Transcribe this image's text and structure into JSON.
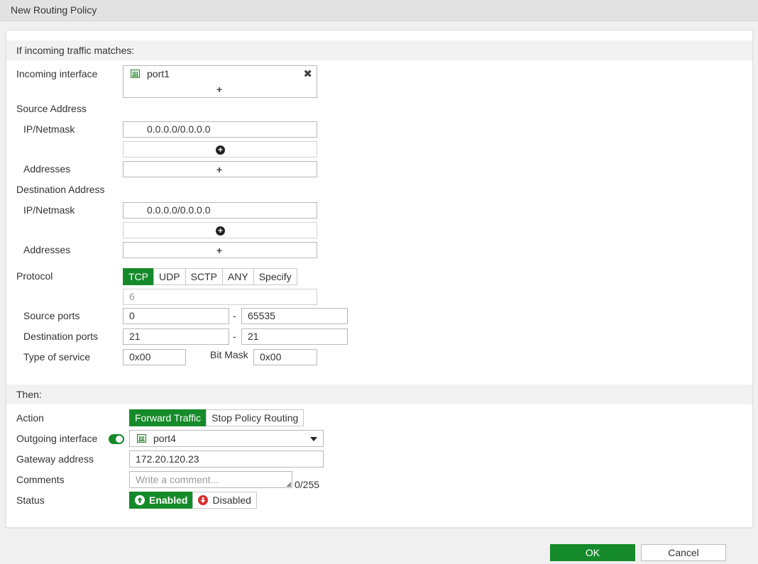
{
  "window": {
    "title": "New Routing Policy"
  },
  "match_section": {
    "header": "If incoming traffic matches:"
  },
  "incoming_interface": {
    "label": "Incoming interface",
    "value": "port1",
    "add": "+"
  },
  "source_address": {
    "label": "Source Address",
    "ip_label": "IP/Netmask",
    "ip_value": "0.0.0.0/0.0.0.0",
    "addresses_label": "Addresses",
    "add": "+"
  },
  "destination_address": {
    "label": "Destination Address",
    "ip_label": "IP/Netmask",
    "ip_value": "0.0.0.0/0.0.0.0",
    "addresses_label": "Addresses",
    "add": "+"
  },
  "protocol": {
    "label": "Protocol",
    "options": [
      "TCP",
      "UDP",
      "SCTP",
      "ANY",
      "Specify"
    ],
    "selected": "TCP",
    "number": "6"
  },
  "ports": {
    "source_label": "Source ports",
    "source_from": "0",
    "source_to": "65535",
    "dest_label": "Destination ports",
    "dest_from": "21",
    "dest_to": "21",
    "dash": "-"
  },
  "tos": {
    "label": "Type of service",
    "value": "0x00",
    "bitmask_label": "Bit Mask",
    "bitmask_value": "0x00"
  },
  "then_section": {
    "header": "Then:"
  },
  "action": {
    "label": "Action",
    "options": [
      "Forward Traffic",
      "Stop Policy Routing"
    ],
    "selected": "Forward Traffic"
  },
  "outgoing_interface": {
    "label": "Outgoing interface",
    "enabled": true,
    "value": "port4"
  },
  "gateway": {
    "label": "Gateway address",
    "value": "172.20.120.23"
  },
  "comments": {
    "label": "Comments",
    "placeholder": "Write a comment...",
    "counter": "0/255"
  },
  "status": {
    "label": "Status",
    "enabled_label": "Enabled",
    "disabled_label": "Disabled",
    "selected": "Enabled"
  },
  "footer": {
    "ok_label": "OK",
    "cancel_label": "Cancel"
  },
  "colors": {
    "accent": "#158a2a",
    "disabled_red": "#d32f2f"
  }
}
